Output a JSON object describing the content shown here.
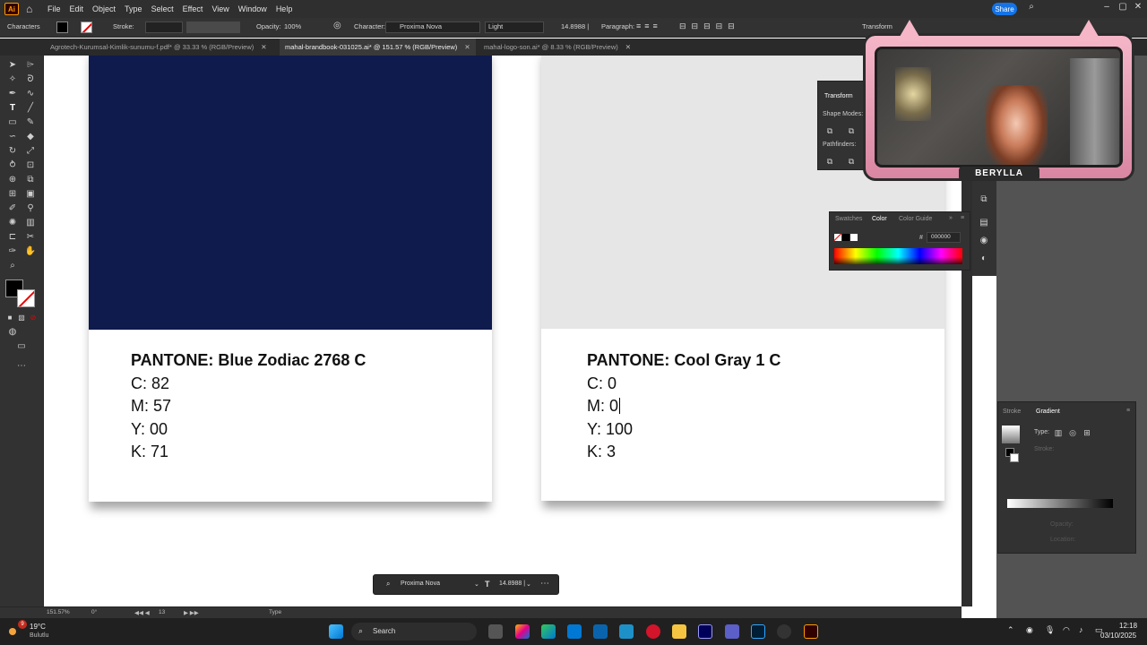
{
  "menubar": {
    "app_icon": "Ai",
    "items": [
      "File",
      "Edit",
      "Object",
      "Type",
      "Select",
      "Effect",
      "View",
      "Window",
      "Help"
    ],
    "share": "Share"
  },
  "control_bar": {
    "panel_name": "Characters",
    "stroke_label": "Stroke:",
    "opacity_label": "Opacity:",
    "opacity_value": "100%",
    "character_label": "Character:",
    "font_family": "Proxima Nova",
    "font_style": "Light",
    "font_size": "14.8988 |",
    "paragraph_label": "Paragraph:",
    "transform_label": "Transform"
  },
  "tabs": [
    {
      "label": "Agrotech-Kurumsal-Kimlik-sunumu-f.pdf* @ 33.33 % (RGB/Preview)",
      "active": false
    },
    {
      "label": "mahal-brandbook-031025.ai* @ 151.57 % (RGB/Preview)",
      "active": true
    },
    {
      "label": "mahal-logo-son.ai* @ 8.33 % (RGB/Preview)",
      "active": false
    }
  ],
  "canvas": {
    "cards": [
      {
        "swatch_color": "#0f1a4d",
        "title": "PANTONE: Blue Zodiac 2768 C",
        "c": "C: 82",
        "m": "M: 57",
        "y": "Y: 00",
        "k": "K: 71"
      },
      {
        "swatch_color": "#e6e6e6",
        "title": "PANTONE: Cool Gray 1 C",
        "c": "C: 0",
        "m": "M: 0",
        "y": "Y: 100",
        "k": "K: 3"
      }
    ]
  },
  "panels": {
    "transform": {
      "title": "Transform",
      "shape_modes": "Shape Modes:",
      "pathfinders": "Pathfinders:"
    },
    "color": {
      "tab_swatches": "Swatches",
      "tab_color": "Color",
      "tab_guide": "Color Guide",
      "hex_symbol": "#",
      "hex_value": "000000"
    },
    "gradient": {
      "tab_stroke": "Stroke",
      "tab_gradient": "Gradient",
      "type_label": "Type:",
      "stroke_label": "Stroke:",
      "opacity_label": "Opacity:",
      "location_label": "Location:"
    }
  },
  "webcam": {
    "name": "BERYLLA"
  },
  "status_bar": {
    "zoom": "151.57%",
    "rotation": "0°",
    "artboard": "13",
    "tool": "Type"
  },
  "floating_bar": {
    "font": "Proxima Nova",
    "size": "14.8988 |"
  },
  "taskbar": {
    "temperature": "19°C",
    "weather": "Bulutlu",
    "notification_count": "9",
    "search": "Search",
    "time": "12:18",
    "date": "03/10/2025"
  },
  "colors": {
    "accent_blue": "#1473e6",
    "illustrator_orange": "#ff9a00",
    "blue_zodiac": "#0f1a4d",
    "cool_gray": "#e6e6e6"
  }
}
